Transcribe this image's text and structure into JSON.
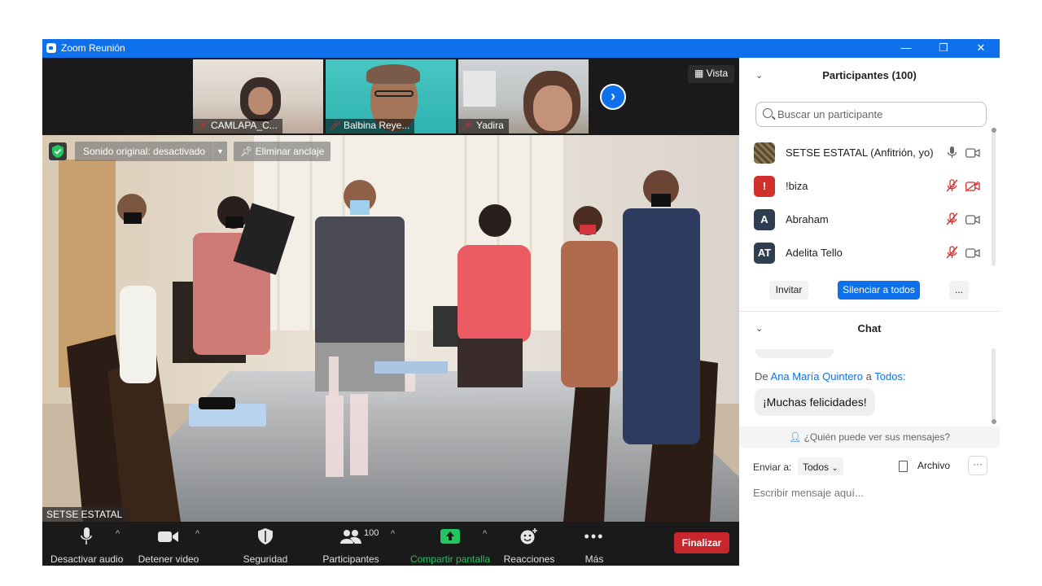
{
  "window": {
    "title": "Zoom Reunión",
    "minimize": "—",
    "restore": "❐",
    "close": "✕"
  },
  "thumbnails": [
    {
      "name": "CAMLAPA_C..."
    },
    {
      "name": "Balbina Reye..."
    },
    {
      "name": "Yadira"
    }
  ],
  "view_button": {
    "label": "Vista"
  },
  "main_video": {
    "original_sound": "Sonido original: desactivado",
    "unpin": "Eliminar anclaje",
    "speaker_name": "SETSE ESTATAL"
  },
  "toolbar": {
    "mute": "Desactivar audio",
    "stop_video": "Detener video",
    "security": "Seguridad",
    "participants": "Participantes",
    "participants_count": "100",
    "share": "Compartir pantalla",
    "reactions": "Reacciones",
    "more": "Más",
    "end": "Finalizar"
  },
  "participants_panel": {
    "title": "Participantes (100)",
    "search_placeholder": "Buscar un participante",
    "items": [
      {
        "initials": "",
        "name": "SETSE ESTATAL (Anfitrión, yo)",
        "avatar_color": "#6b5a3a",
        "muted": false,
        "video_off": false
      },
      {
        "initials": "!",
        "name": "!biza",
        "avatar_color": "#d0312d",
        "muted": true,
        "video_off": true
      },
      {
        "initials": "A",
        "name": "Abraham",
        "avatar_color": "#2e3d4f",
        "muted": true,
        "video_off": false
      },
      {
        "initials": "AT",
        "name": "Adelita Tello",
        "avatar_color": "#2e3d4f",
        "muted": true,
        "video_off": false
      }
    ],
    "invite": "Invitar",
    "mute_all": "Silenciar a todos",
    "more": "..."
  },
  "chat": {
    "title": "Chat",
    "from_prefix": "De",
    "from_name": "Ana María Quintero",
    "to_word": "a",
    "to_name": "Todos:",
    "message": "¡Muchas felicidades!",
    "who_can_see": "¿Quién puede ver sus mensajes?",
    "send_to_label": "Enviar a:",
    "send_to_value": "Todos",
    "file_label": "Archivo",
    "more": "···",
    "input_placeholder": "Escribir mensaje aquí..."
  },
  "colors": {
    "titlebar": "#0e71eb",
    "end_button": "#c8262d",
    "share_green": "#22c55e",
    "mute_red": "#e02828"
  }
}
